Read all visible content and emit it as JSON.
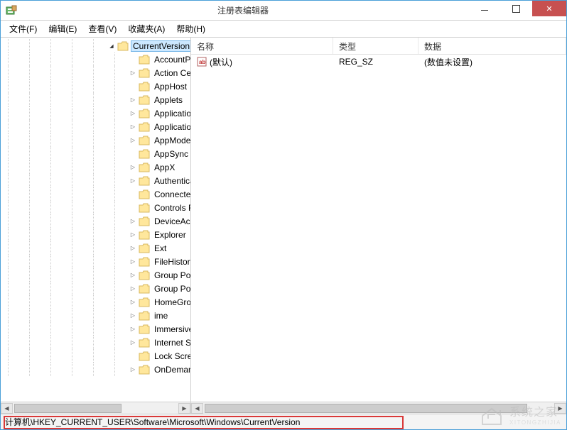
{
  "window": {
    "title": "注册表编辑器"
  },
  "menu": {
    "file": "文件(F)",
    "edit": "编辑(E)",
    "view": "查看(V)",
    "favorites": "收藏夹(A)",
    "help": "帮助(H)"
  },
  "tree": {
    "selected": "CurrentVersion",
    "children": [
      {
        "label": "AccountPicture",
        "expandable": false
      },
      {
        "label": "Action Center",
        "expandable": true
      },
      {
        "label": "AppHost",
        "expandable": false
      },
      {
        "label": "Applets",
        "expandable": true
      },
      {
        "label": "ApplicationAss",
        "expandable": true
      },
      {
        "label": "ApplicationVie",
        "expandable": true
      },
      {
        "label": "AppModel",
        "expandable": true
      },
      {
        "label": "AppSync",
        "expandable": false
      },
      {
        "label": "AppX",
        "expandable": true
      },
      {
        "label": "Authentication",
        "expandable": true
      },
      {
        "label": "ConnectedSea",
        "expandable": false
      },
      {
        "label": "Controls Folde",
        "expandable": false
      },
      {
        "label": "DeviceAccess",
        "expandable": true
      },
      {
        "label": "Explorer",
        "expandable": true
      },
      {
        "label": "Ext",
        "expandable": true
      },
      {
        "label": "FileHistory",
        "expandable": true
      },
      {
        "label": "Group Policy",
        "expandable": true
      },
      {
        "label": "Group Policy E",
        "expandable": true
      },
      {
        "label": "HomeGroup",
        "expandable": true
      },
      {
        "label": "ime",
        "expandable": true
      },
      {
        "label": "ImmersiveShel",
        "expandable": true
      },
      {
        "label": "Internet Setting",
        "expandable": true
      },
      {
        "label": "Lock Screen",
        "expandable": false
      },
      {
        "label": "OnDemandInte",
        "expandable": true
      }
    ]
  },
  "list": {
    "columns": {
      "name": "名称",
      "type": "类型",
      "data": "数据"
    },
    "rows": [
      {
        "name": "(默认)",
        "type": "REG_SZ",
        "data": "(数值未设置)"
      }
    ]
  },
  "statusbar": {
    "path": "计算机\\HKEY_CURRENT_USER\\Software\\Microsoft\\Windows\\CurrentVersion"
  },
  "watermark": {
    "text": "系统之家",
    "sub": "XITONGZHIJIA"
  }
}
